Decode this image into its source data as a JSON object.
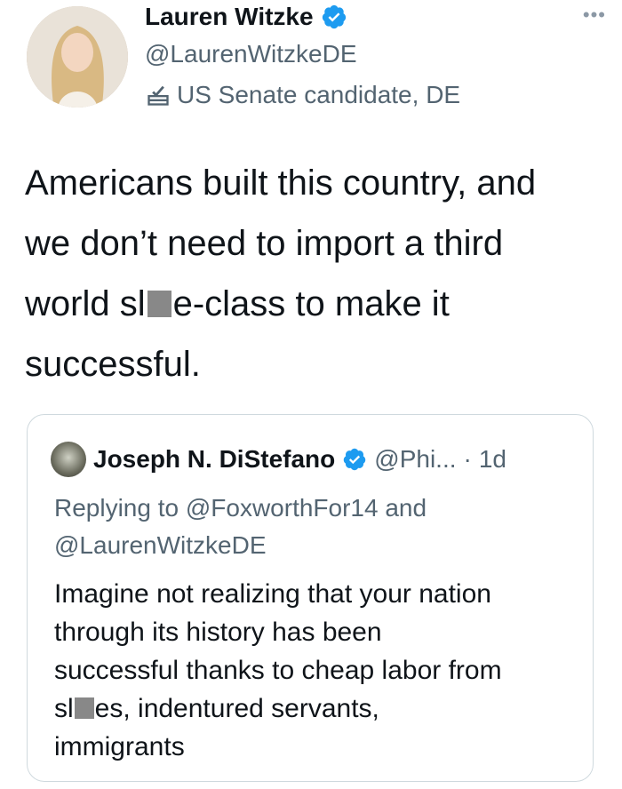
{
  "tweet": {
    "author_name": "Lauren Witzke",
    "author_handle": "@LaurenWitzkeDE",
    "label_text": "US Senate candidate, DE",
    "label_icon": "ballot-box-icon",
    "more_icon": "more-options-icon",
    "text_line1": "Americans built this country, and",
    "text_line2": "we don’t need to import a third",
    "text_line3_pre": "world sl",
    "text_line3_post": "e-class to make it",
    "text_line4": "successful."
  },
  "quote": {
    "author_name": "Joseph N. DiStefano",
    "author_handle": "@Phi...",
    "separator": "·",
    "time": "1d",
    "replying_line1": "Replying to @FoxworthFor14 and",
    "replying_line2": "@LaurenWitzkeDE",
    "body_line1": "Imagine not realizing that your nation",
    "body_line2": "through its history has been",
    "body_line3": "successful thanks to cheap labor from",
    "body_line4_pre": "sl",
    "body_line4_post": "es, indentured servants,",
    "body_line5": "immigrants"
  },
  "colors": {
    "verified": "#1d9bf0",
    "secondary_text": "#536471",
    "border": "#cfd9de"
  }
}
